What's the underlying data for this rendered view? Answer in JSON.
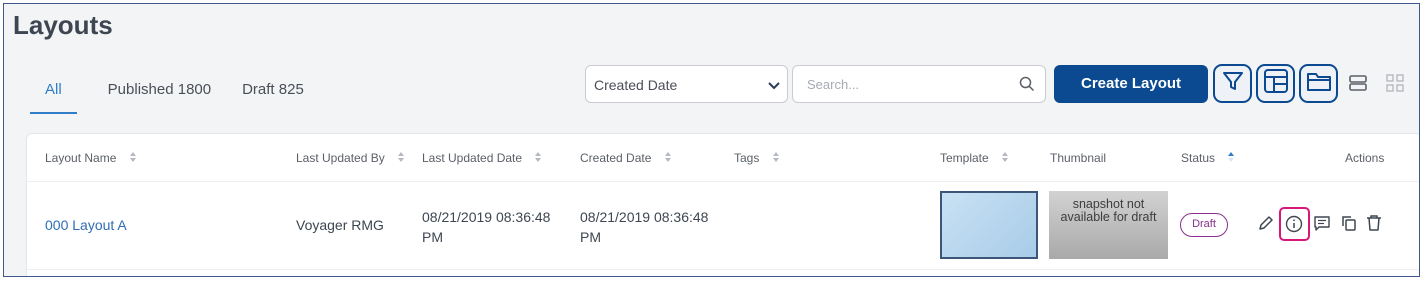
{
  "page": {
    "title": "Layouts"
  },
  "tabs": [
    {
      "label": "All",
      "active": true
    },
    {
      "label": "Published 1800",
      "active": false
    },
    {
      "label": "Draft 825",
      "active": false
    }
  ],
  "toolbar": {
    "sort_select": {
      "value": "Created Date"
    },
    "search": {
      "placeholder": "Search..."
    },
    "create_button": "Create Layout",
    "icons": [
      "filter-icon",
      "layout-template-icon",
      "folder-icon",
      "list-view-icon",
      "grid-view-icon"
    ]
  },
  "table": {
    "columns": [
      "Layout Name",
      "Last Updated By",
      "Last Updated Date",
      "Created Date",
      "Tags",
      "Template",
      "Thumbnail",
      "Status",
      "Actions"
    ],
    "rows": [
      {
        "layout_name": "000 Layout A",
        "last_updated_by": "Voyager RMG",
        "last_updated_date": "08/21/2019 08:36:48 PM",
        "created_date": "08/21/2019 08:36:48 PM",
        "tags": "",
        "thumbnail_text": "snapshot not available for draft",
        "status": "Draft",
        "actions": [
          "edit-icon",
          "info-icon",
          "comment-icon",
          "copy-icon",
          "delete-icon"
        ]
      }
    ]
  },
  "colors": {
    "primary": "#0b4a91",
    "link": "#2f7ec7",
    "draft": "#8a2f8f",
    "highlight": "#d8177b"
  }
}
